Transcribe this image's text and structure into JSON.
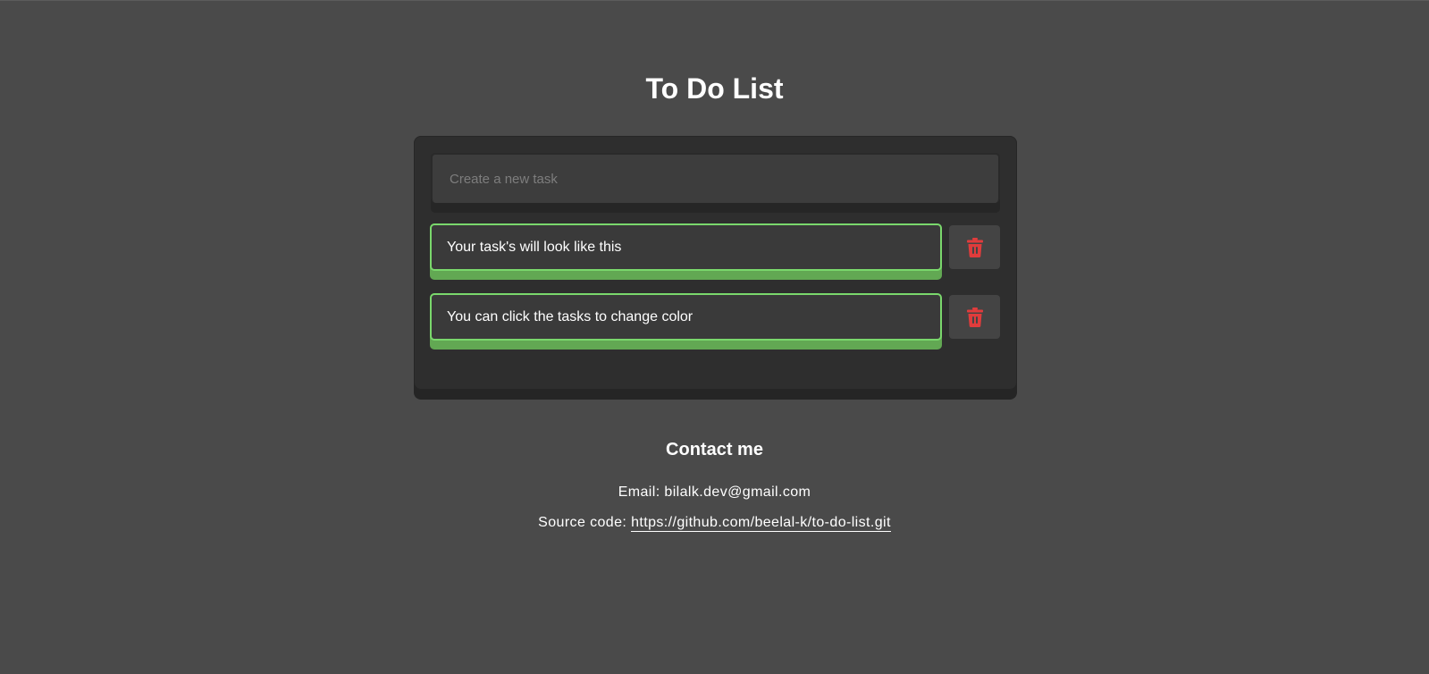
{
  "title": "To Do List",
  "new_task": {
    "placeholder": "Create a new task",
    "value": ""
  },
  "tasks": [
    {
      "text": "Your task's will look like this",
      "color": "#7ad86c"
    },
    {
      "text": "You can click the tasks to change color",
      "color": "#7ad86c"
    }
  ],
  "icons": {
    "delete": "trash-icon"
  },
  "colors": {
    "background": "#4a4a4a",
    "card": "#2e2e2e",
    "task_accent": "#7ad86c",
    "delete_icon": "#e03c3c"
  },
  "contact": {
    "title": "Contact me",
    "email_label": "Email:",
    "email": "bilalk.dev@gmail.com",
    "source_label": "Source code:",
    "source_link": "https://github.com/beelal-k/to-do-list.git"
  }
}
